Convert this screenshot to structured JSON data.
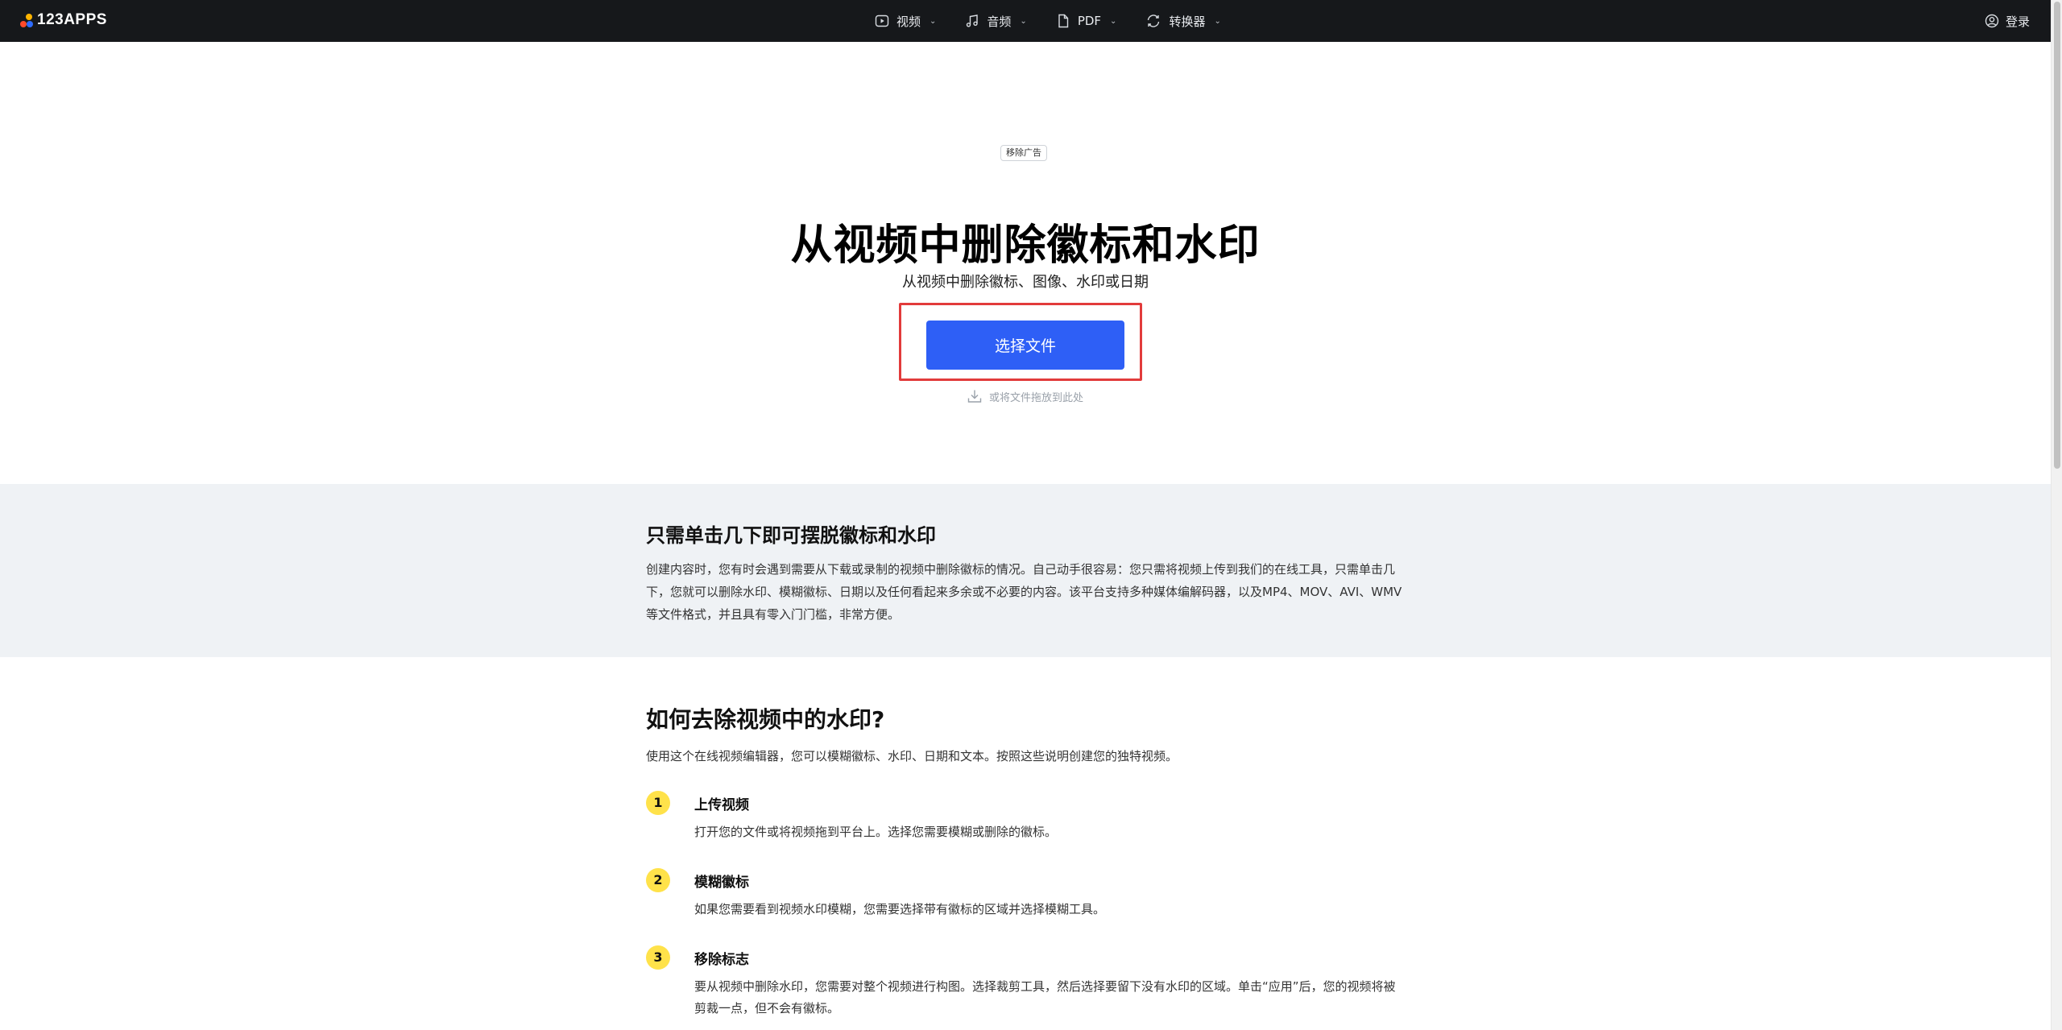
{
  "header": {
    "logo_text": "123APPS",
    "nav": [
      {
        "label": "视频",
        "icon": "video-play-icon"
      },
      {
        "label": "音频",
        "icon": "music-note-icon"
      },
      {
        "label": "PDF",
        "icon": "document-icon"
      },
      {
        "label": "转换器",
        "icon": "convert-icon"
      }
    ],
    "login_label": "登录"
  },
  "hero": {
    "remove_ads": "移除广告",
    "title": "从视频中删除徽标和水印",
    "subtitle": "从视频中删除徽标、图像、水印或日期",
    "choose_file": "选择文件",
    "drop_hint": "或将文件拖放到此处"
  },
  "intro": {
    "title": "只需单击几下即可摆脱徽标和水印",
    "body": "创建内容时，您有时会遇到需要从下载或录制的视频中删除徽标的情况。自己动手很容易：您只需将视频上传到我们的在线工具，只需单击几下，您就可以删除水印、模糊徽标、日期以及任何看起来多余或不必要的内容。该平台支持多种媒体编解码器，以及MP4、MOV、AVI、WMV等文件格式，并且具有零入门门槛，非常方便。"
  },
  "howto": {
    "title": "如何去除视频中的水印?",
    "description": "使用这个在线视频编辑器，您可以模糊徽标、水印、日期和文本。按照这些说明创建您的独特视频。",
    "steps": [
      {
        "num": "1",
        "title": "上传视频",
        "text": "打开您的文件或将视频拖到平台上。选择您需要模糊或删除的徽标。"
      },
      {
        "num": "2",
        "title": "模糊徽标",
        "text": "如果您需要看到视频水印模糊，您需要选择带有徽标的区域并选择模糊工具。"
      },
      {
        "num": "3",
        "title": "移除标志",
        "text": "要从视频中删除水印，您需要对整个视频进行构图。选择裁剪工具，然后选择要留下没有水印的区域。单击“应用”后，您的视频将被剪裁一点，但不会有徽标。"
      }
    ]
  },
  "colors": {
    "topbar": "#16181b",
    "accent_button": "#2e5ff6",
    "highlight": "#e23b3b",
    "step_badge": "#ffe24a",
    "intro_bg": "#eff2f5"
  }
}
